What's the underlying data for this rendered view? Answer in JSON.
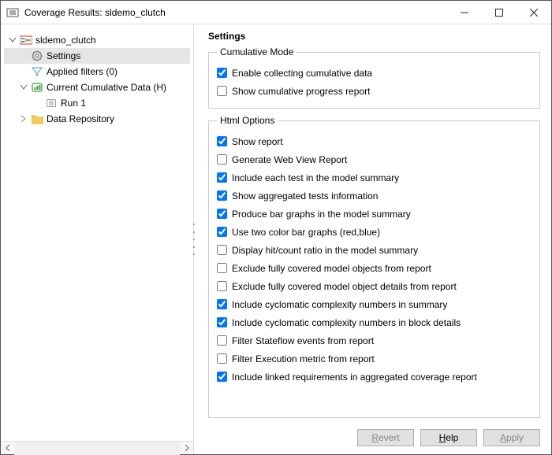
{
  "window": {
    "title": "Coverage Results: sldemo_clutch"
  },
  "tree": {
    "root": "sldemo_clutch",
    "settings": "Settings",
    "applied_filters": "Applied filters (0)",
    "current_cumulative": "Current Cumulative Data (H)",
    "run1": "Run 1",
    "data_repo": "Data Repository"
  },
  "settings": {
    "heading": "Settings",
    "cumulative": {
      "legend": "Cumulative Mode",
      "items": [
        {
          "label": "Enable collecting cumulative data",
          "checked": true
        },
        {
          "label": "Show cumulative progress report",
          "checked": false
        }
      ]
    },
    "html": {
      "legend": "Html Options",
      "items": [
        {
          "label": "Show report",
          "checked": true
        },
        {
          "label": "Generate Web View Report",
          "checked": false
        },
        {
          "label": "Include each test in the model summary",
          "checked": true
        },
        {
          "label": "Show aggregated tests information",
          "checked": true
        },
        {
          "label": "Produce bar graphs in the model summary",
          "checked": true
        },
        {
          "label": "Use two color bar graphs (red,blue)",
          "checked": true
        },
        {
          "label": "Display hit/count ratio in the model summary",
          "checked": false
        },
        {
          "label": "Exclude fully covered model objects from report",
          "checked": false
        },
        {
          "label": "Exclude fully covered model object details from report",
          "checked": false
        },
        {
          "label": "Include cyclomatic complexity numbers in summary",
          "checked": true
        },
        {
          "label": "Include cyclomatic complexity numbers in block details",
          "checked": true
        },
        {
          "label": "Filter Stateflow events from report",
          "checked": false
        },
        {
          "label": "Filter Execution metric from report",
          "checked": false
        },
        {
          "label": "Include linked requirements in aggregated coverage report",
          "checked": true
        }
      ]
    }
  },
  "buttons": {
    "revert": "Revert",
    "help": "Help",
    "apply": "Apply"
  }
}
